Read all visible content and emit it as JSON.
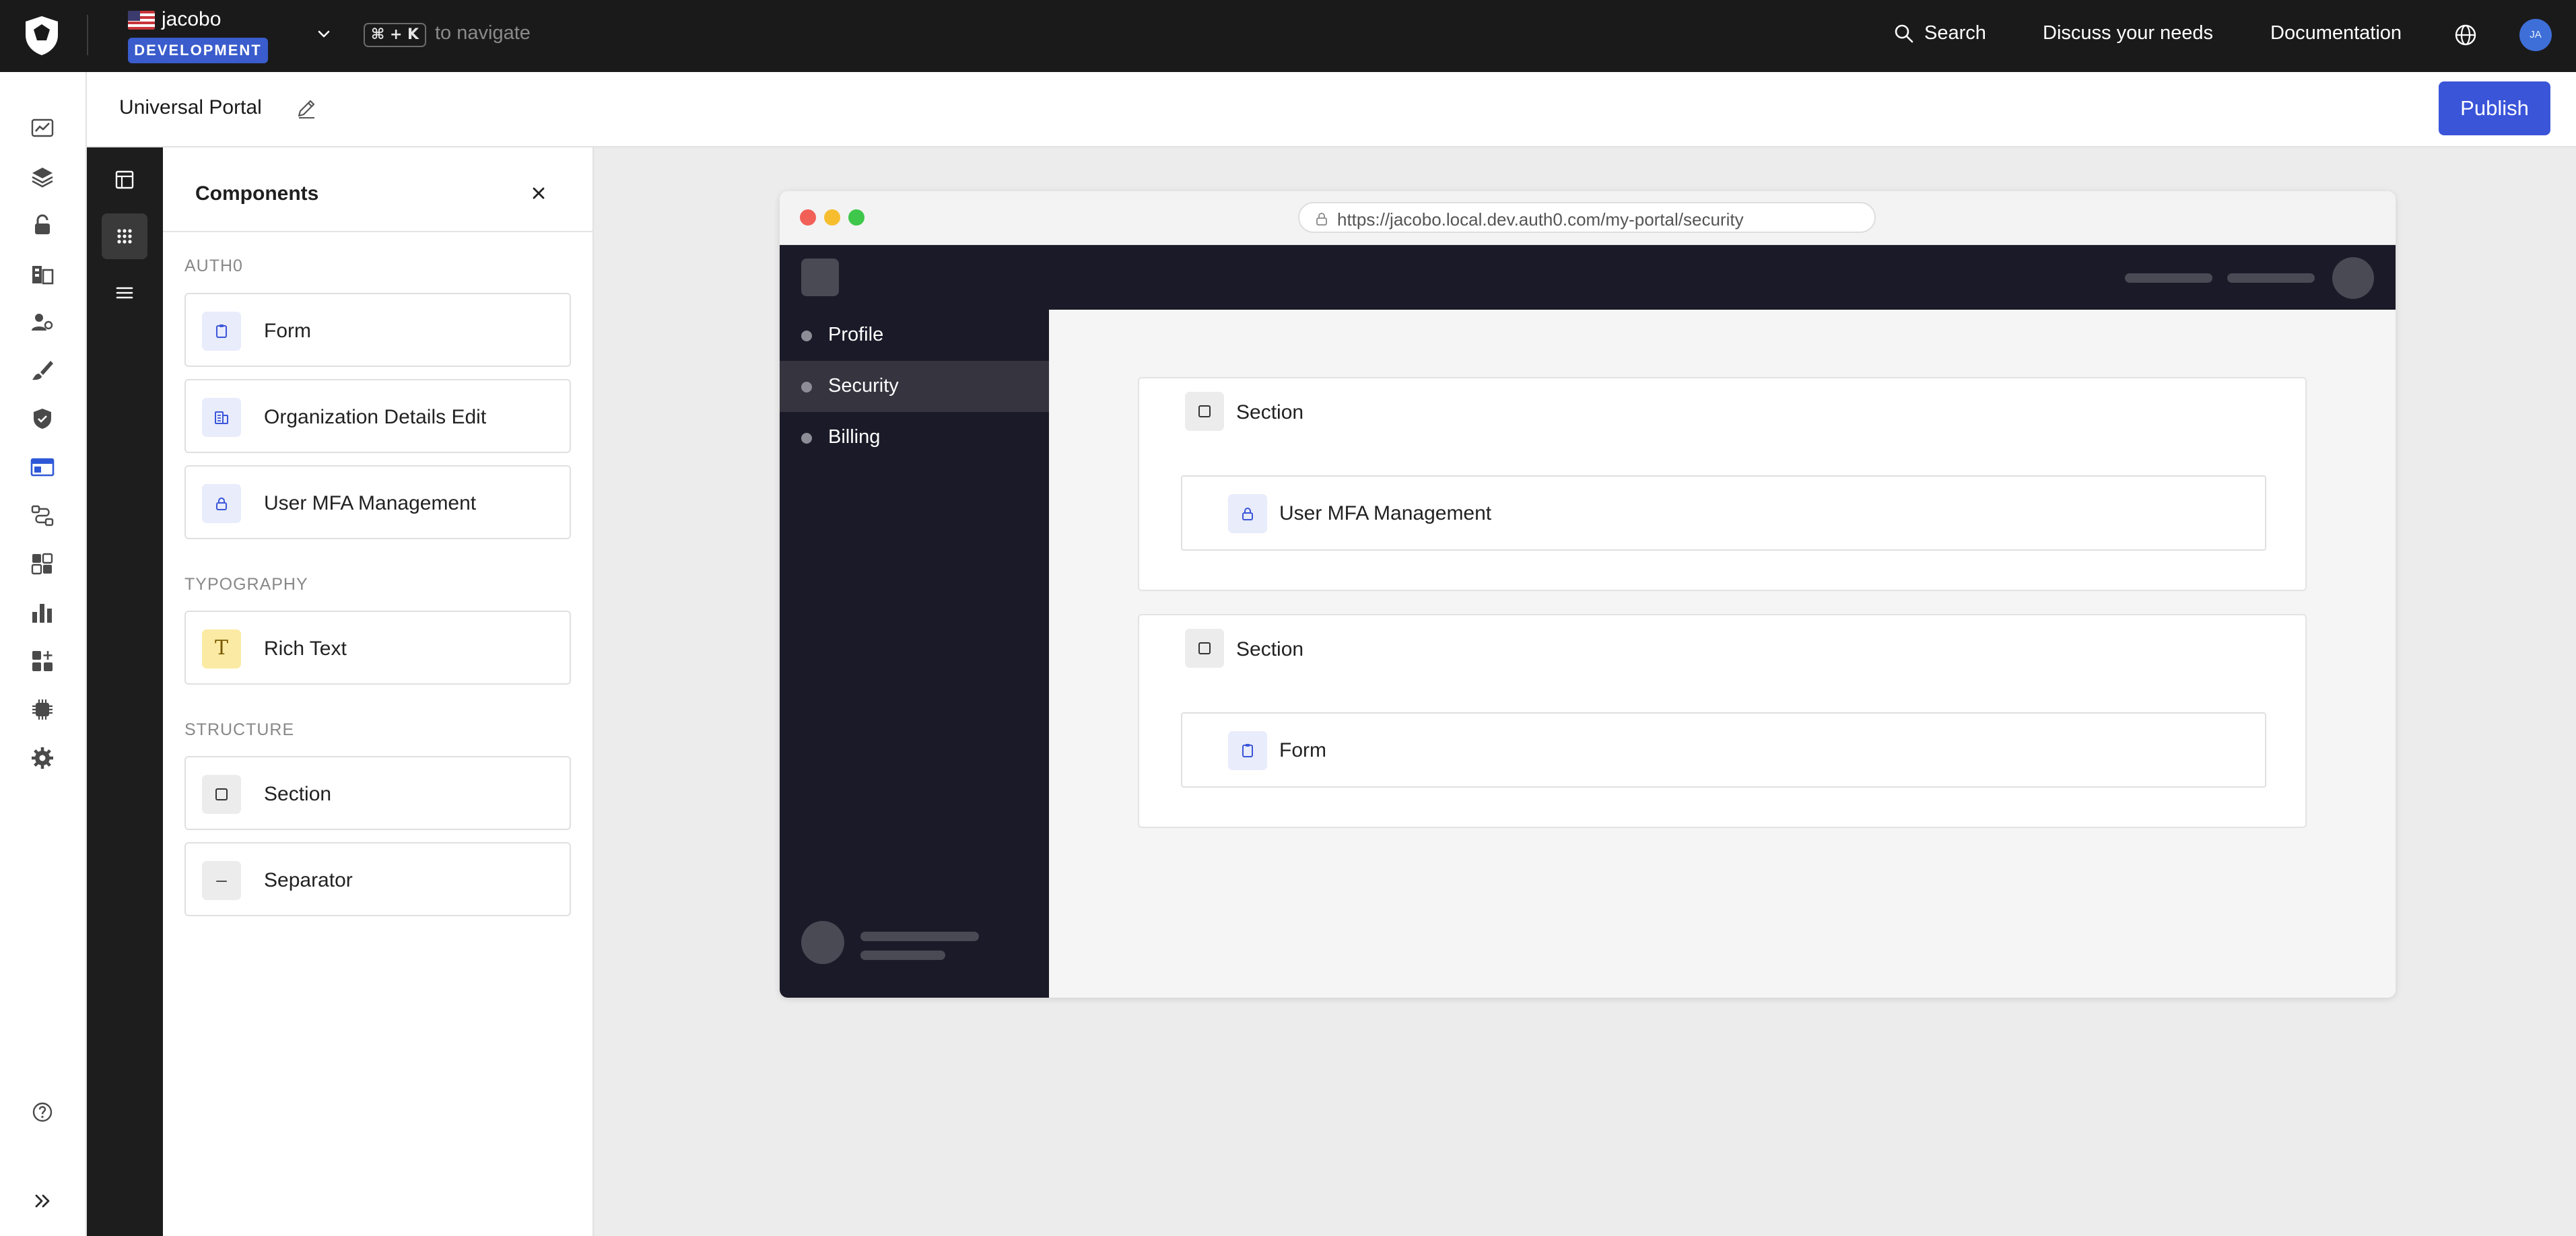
{
  "topbar": {
    "tenant_name": "jacobo",
    "environment_badge": "DEVELOPMENT",
    "shortcut": "⌘ + K",
    "shortcut_hint": "to navigate",
    "search_label": "Search",
    "discuss_label": "Discuss your needs",
    "docs_label": "Documentation",
    "avatar_initials": "JA"
  },
  "rail": {
    "icons": [
      "activity-icon",
      "layers-icon",
      "lock-icon",
      "organizations-icon",
      "users-icon",
      "branding-brush-icon",
      "security-shield-icon",
      "portal-icon",
      "actions-flow-icon",
      "extensions-icon",
      "monitoring-chart-icon",
      "marketplace-icon",
      "chip-icon",
      "settings-gear-icon",
      "help-icon",
      "expand-icon"
    ]
  },
  "subheader": {
    "portal_name": "Universal Portal",
    "publish_label": "Publish"
  },
  "toolrail": {
    "tools": [
      "layout-icon",
      "components-grid-icon",
      "menu-icon"
    ]
  },
  "panel": {
    "title": "Components",
    "groups": [
      {
        "label": "AUTH0",
        "items": [
          {
            "label": "Form",
            "icon": "clipboard-icon"
          },
          {
            "label": "Organization Details Edit",
            "icon": "buildings-icon"
          },
          {
            "label": "User MFA Management",
            "icon": "lock-icon"
          }
        ]
      },
      {
        "label": "TYPOGRAPHY",
        "items": [
          {
            "label": "Rich Text",
            "icon": "text-icon",
            "glyph": "T"
          }
        ]
      },
      {
        "label": "STRUCTURE",
        "items": [
          {
            "label": "Section",
            "icon": "square-icon"
          },
          {
            "label": "Separator",
            "icon": "dash-icon",
            "glyph": "–"
          }
        ]
      }
    ]
  },
  "preview": {
    "url": "https://jacobo.local.dev.auth0.com/my-portal/security",
    "nav": [
      {
        "label": "Profile",
        "active": false
      },
      {
        "label": "Security",
        "active": true
      },
      {
        "label": "Billing",
        "active": false
      }
    ],
    "sections": [
      {
        "label": "Section",
        "child": "User MFA Management"
      },
      {
        "label": "Section",
        "child": "Form"
      }
    ]
  },
  "colors": {
    "accent": "#3b55d9",
    "topbar": "#1a1a1a",
    "site_dark": "#1b1a28",
    "badge": "#3a5ccc"
  }
}
